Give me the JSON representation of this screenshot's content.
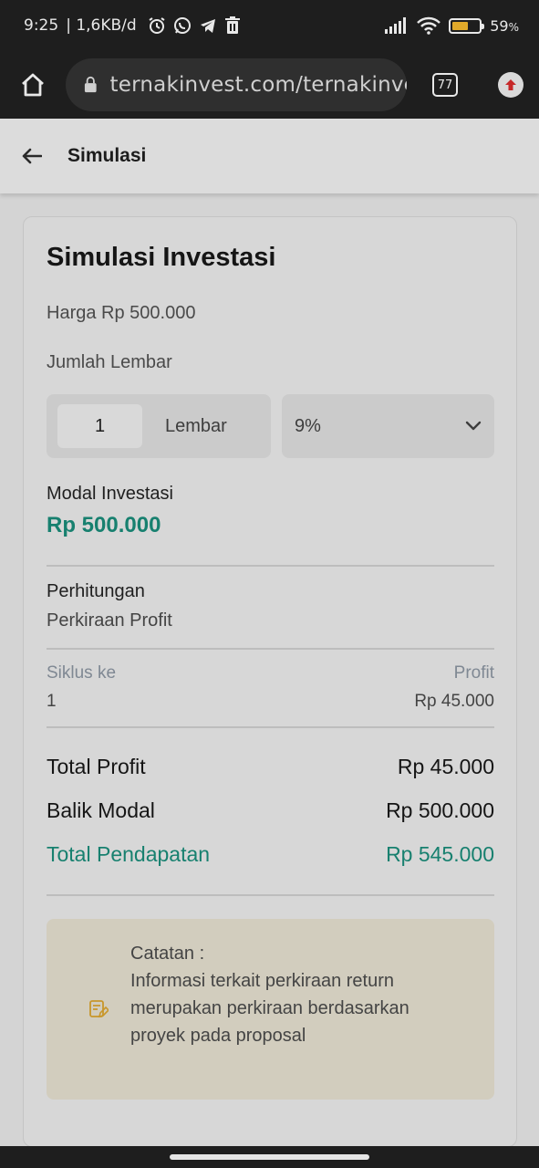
{
  "status_bar": {
    "time": "9:25",
    "network_speed": "| 1,6KB/d",
    "battery_percent": "59",
    "battery_suffix": "%",
    "battery_level": 0.59,
    "icons": [
      "alarm-icon",
      "whatsapp-icon",
      "telegram-icon",
      "trash-icon",
      "signal-icon",
      "wifi-icon",
      "battery-icon"
    ]
  },
  "browser": {
    "url": "ternakinvest.com/ternakinvest",
    "tab_count": "77",
    "icons": [
      "home-icon",
      "lock-icon",
      "tabs-icon",
      "update-icon"
    ]
  },
  "header": {
    "title": "Simulasi"
  },
  "card": {
    "title": "Simulasi Investasi",
    "price": "Harga Rp 500.000",
    "quantity_label": "Jumlah Lembar",
    "quantity_value": "1",
    "quantity_unit": "Lembar",
    "percent_selected": "9%",
    "modal_label": "Modal Investasi",
    "modal_value": "Rp 500.000",
    "calc_label": "Perhitungan",
    "calc_sub": "Perkiraan Profit",
    "table": {
      "headers": [
        "Siklus ke",
        "Profit"
      ],
      "rows": [
        {
          "cycle": "1",
          "profit": "Rp 45.000"
        }
      ]
    },
    "summary": {
      "total_profit_label": "Total Profit",
      "total_profit_value": "Rp 45.000",
      "return_label": "Balik Modal",
      "return_value": "Rp 500.000",
      "income_label": "Total Pendapatan",
      "income_value": "Rp 545.000"
    },
    "note": {
      "title": "Catatan :",
      "body": "Informasi terkait perkiraan return merupakan perkiraan berdasarkan proyek pada proposal"
    }
  },
  "colors": {
    "accent_teal": "#17806f",
    "note_background": "#d2cdbe",
    "note_icon": "#c8962a",
    "update_icon": "#c62828"
  }
}
